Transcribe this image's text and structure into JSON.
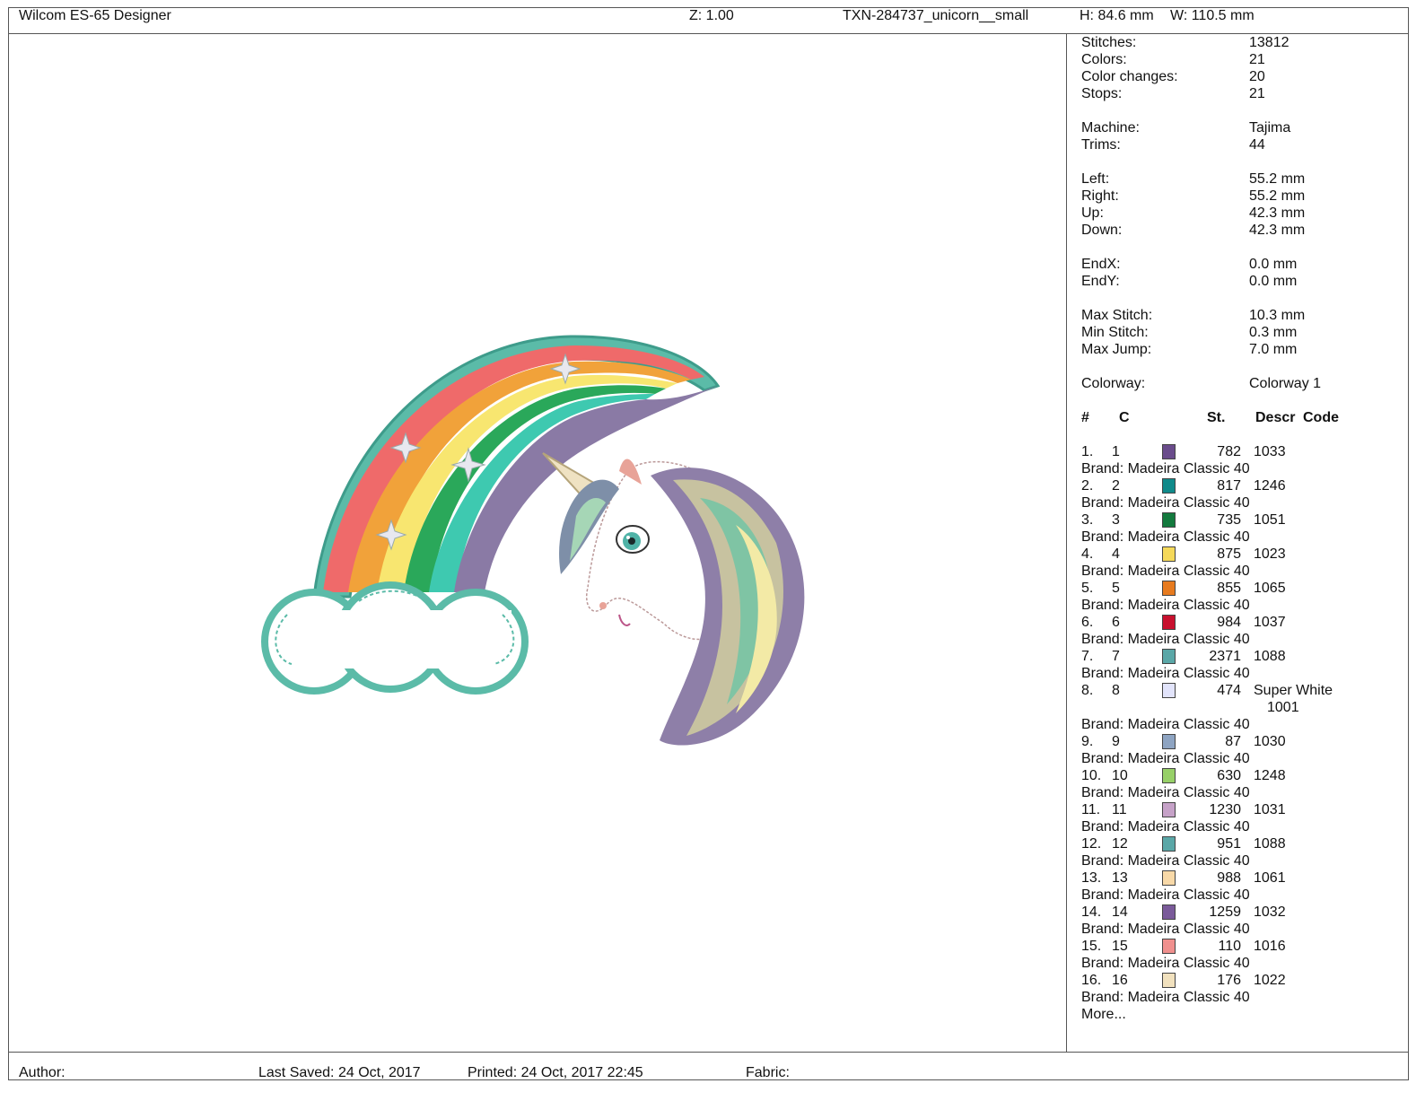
{
  "header": {
    "app_title": "Wilcom ES-65 Designer",
    "zoom": "Z: 1.00",
    "file_name": "TXN-284737_unicorn__small",
    "height": "H: 84.6 mm",
    "width": "W: 110.5 mm"
  },
  "footer": {
    "author": "Author:",
    "last_saved": "Last Saved: 24 Oct, 2017",
    "printed": "Printed: 24 Oct, 2017 22:45",
    "fabric": "Fabric:"
  },
  "stats": {
    "stitches_label": "Stitches:",
    "stitches": "13812",
    "colors_label": "Colors:",
    "colors": "21",
    "color_changes_label": "Color changes:",
    "color_changes": "20",
    "stops_label": "Stops:",
    "stops": "21",
    "machine_label": "Machine:",
    "machine": "Tajima",
    "trims_label": "Trims:",
    "trims": "44",
    "left_label": "Left:",
    "left": "55.2 mm",
    "right_label": "Right:",
    "right": "55.2 mm",
    "up_label": "Up:",
    "up": "42.3 mm",
    "down_label": "Down:",
    "down": "42.3 mm",
    "endx_label": "EndX:",
    "endx": "0.0 mm",
    "endy_label": "EndY:",
    "endy": "0.0 mm",
    "max_stitch_label": "Max Stitch:",
    "max_stitch": "10.3 mm",
    "min_stitch_label": "Min Stitch:",
    "min_stitch": "0.3 mm",
    "max_jump_label": "Max Jump:",
    "max_jump": "7.0 mm",
    "colorway_label": "Colorway:",
    "colorway": "Colorway 1"
  },
  "table_headers": {
    "num": "#",
    "c": "C",
    "st": "St.",
    "descr": "Descr",
    "code": "Code"
  },
  "colors": [
    {
      "num": "1.",
      "c": "1",
      "color": "#6a4c8c",
      "st": "782",
      "code": "1033",
      "brand": "Brand: Madeira Classic 40"
    },
    {
      "num": "2.",
      "c": "2",
      "color": "#0f8a8a",
      "st": "817",
      "code": "1246",
      "brand": "Brand: Madeira Classic 40"
    },
    {
      "num": "3.",
      "c": "3",
      "color": "#137a3e",
      "st": "735",
      "code": "1051",
      "brand": "Brand: Madeira Classic 40"
    },
    {
      "num": "4.",
      "c": "4",
      "color": "#f5d95a",
      "st": "875",
      "code": "1023",
      "brand": "Brand: Madeira Classic 40"
    },
    {
      "num": "5.",
      "c": "5",
      "color": "#e77b1f",
      "st": "855",
      "code": "1065",
      "brand": "Brand: Madeira Classic 40"
    },
    {
      "num": "6.",
      "c": "6",
      "color": "#c8102e",
      "st": "984",
      "code": "1037",
      "brand": "Brand: Madeira Classic 40"
    },
    {
      "num": "7.",
      "c": "7",
      "color": "#5aa7a7",
      "st": "2371",
      "code": "1088",
      "brand": "Brand: Madeira Classic 40"
    },
    {
      "num": "8.",
      "c": "8",
      "color": "#e2e4fb",
      "st": "474",
      "code": "Super White",
      "code2": "1001",
      "brand": "Brand: Madeira Classic 40"
    },
    {
      "num": "9.",
      "c": "9",
      "color": "#8ea4c2",
      "st": "87",
      "code": "1030",
      "brand": "Brand: Madeira Classic 40"
    },
    {
      "num": "10.",
      "c": "10",
      "color": "#97d068",
      "st": "630",
      "code": "1248",
      "brand": "Brand: Madeira Classic 40"
    },
    {
      "num": "11.",
      "c": "11",
      "color": "#c6a2c8",
      "st": "1230",
      "code": "1031",
      "brand": "Brand: Madeira Classic 40"
    },
    {
      "num": "12.",
      "c": "12",
      "color": "#5aa7a7",
      "st": "951",
      "code": "1088",
      "brand": "Brand: Madeira Classic 40"
    },
    {
      "num": "13.",
      "c": "13",
      "color": "#f8d9a8",
      "st": "988",
      "code": "1061",
      "brand": "Brand: Madeira Classic 40"
    },
    {
      "num": "14.",
      "c": "14",
      "color": "#7a5a9a",
      "st": "1259",
      "code": "1032",
      "brand": "Brand: Madeira Classic 40"
    },
    {
      "num": "15.",
      "c": "15",
      "color": "#f0908e",
      "st": "110",
      "code": "1016",
      "brand": "Brand: Madeira Classic 40"
    },
    {
      "num": "16.",
      "c": "16",
      "color": "#f1e1be",
      "st": "176",
      "code": "1022",
      "brand": "Brand: Madeira Classic 40"
    }
  ],
  "more_label": "More..."
}
